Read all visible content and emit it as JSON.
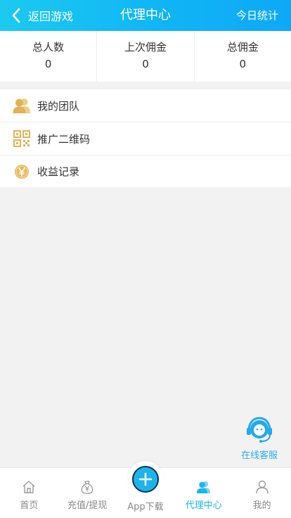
{
  "header": {
    "back_label": "返回游戏",
    "title": "代理中心",
    "stats_label": "今日统计"
  },
  "stats": [
    {
      "label": "总人数",
      "value": "0"
    },
    {
      "label": "上次佣金",
      "value": "0"
    },
    {
      "label": "总佣金",
      "value": "0"
    }
  ],
  "menu": [
    {
      "label": "我的团队",
      "icon": "team-icon"
    },
    {
      "label": "推广二维码",
      "icon": "qrcode-icon"
    },
    {
      "label": "收益记录",
      "icon": "yen-coin-icon"
    }
  ],
  "service": {
    "label": "在线客服",
    "icon": "headset-icon"
  },
  "tabbar": [
    {
      "label": "首页",
      "icon": "home-icon"
    },
    {
      "label": "充值/提现",
      "icon": "money-bag-icon"
    },
    {
      "label": "App下载",
      "icon": "plus-icon"
    },
    {
      "label": "代理中心",
      "icon": "agent-icon",
      "active": true
    },
    {
      "label": "我的",
      "icon": "user-icon"
    }
  ],
  "colors": {
    "accent": "#19b6ef",
    "header_start": "#1ccaf0",
    "header_end": "#0fa8f7",
    "icon_gold": "#e6b95c"
  }
}
